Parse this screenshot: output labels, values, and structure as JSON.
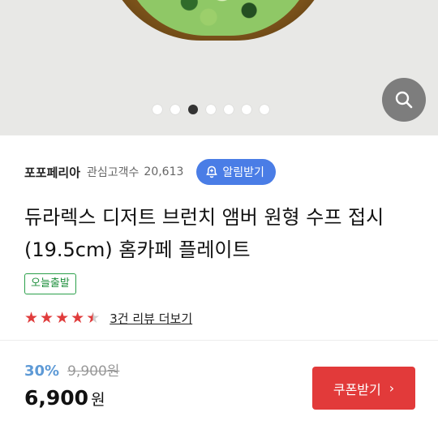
{
  "gallery": {
    "image_count": 7,
    "active_index": 2,
    "zoom_icon": "search-icon"
  },
  "seller": {
    "name": "포포페리아",
    "watchers_label": "관심고객수",
    "watchers_count": "20,613",
    "alert_button_label": "알림받기",
    "alert_icon": "bell-plus-icon",
    "accent_color": "#4a7de6"
  },
  "product": {
    "title": "듀라렉스 디저트 브런치 앰버 원형 수프 접시(19.5cm) 홈카페 플레이트",
    "shipping_badge": "오늘출발",
    "rating": 4.5,
    "rating_max": 5,
    "review_link": "3건 리뷰 더보기"
  },
  "pricing": {
    "discount_rate": "30%",
    "original_price": "9,900원",
    "sale_price": "6,900",
    "currency": "원",
    "coupon_button_label": "쿠폰받기",
    "coupon_button_color": "#e23a3a"
  }
}
